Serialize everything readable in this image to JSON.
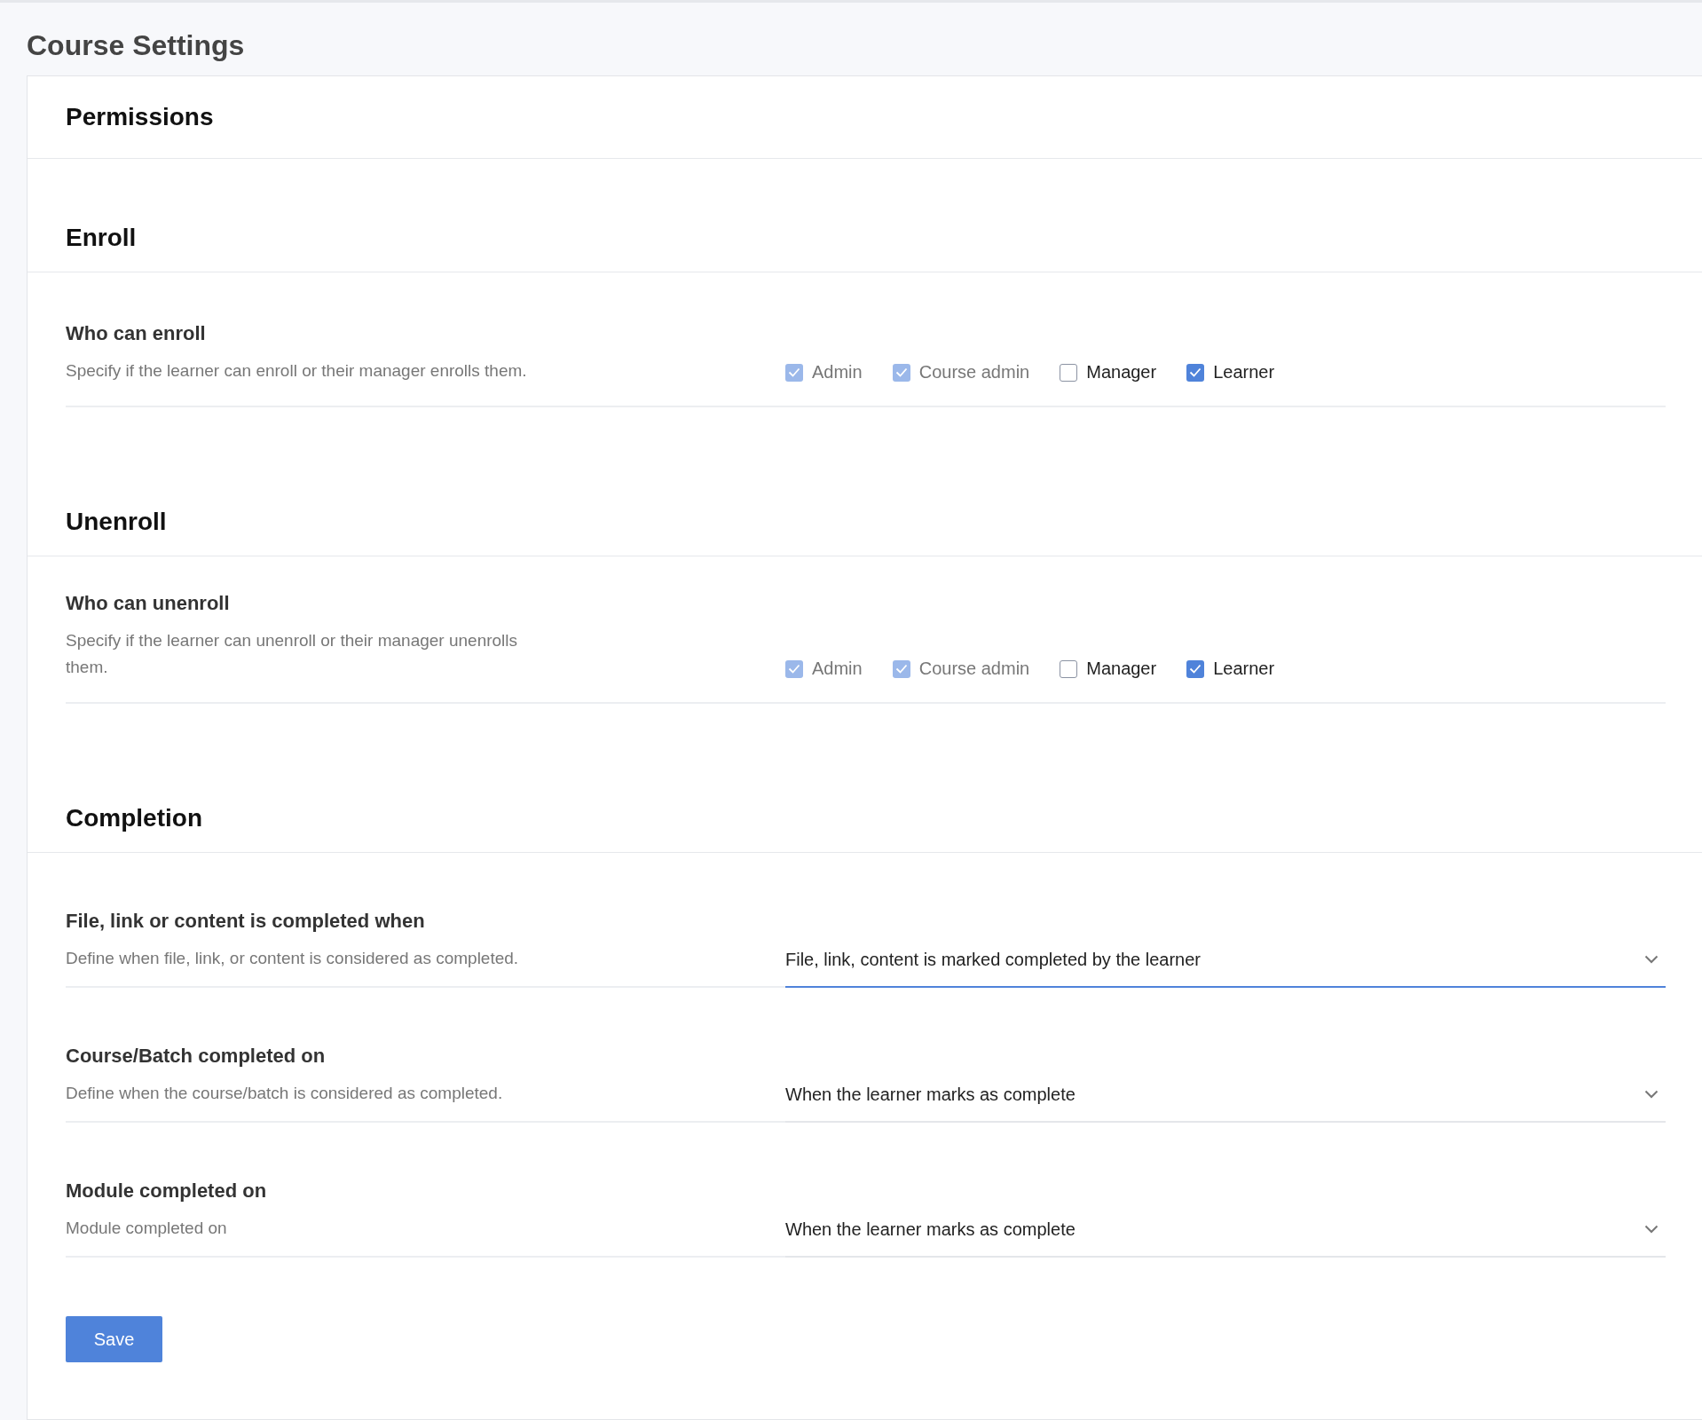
{
  "page_title": "Course Settings",
  "card_title": "Permissions",
  "sections": [
    {
      "heading": "Enroll",
      "rows": [
        {
          "kind": "checkboxes",
          "title": "Who can enroll",
          "description": "Specify if the learner can enroll or their manager enrolls them.",
          "options": [
            {
              "label": "Admin",
              "checked": true,
              "disabled": true
            },
            {
              "label": "Course admin",
              "checked": true,
              "disabled": true
            },
            {
              "label": "Manager",
              "checked": false,
              "disabled": false
            },
            {
              "label": "Learner",
              "checked": true,
              "disabled": false
            }
          ]
        }
      ]
    },
    {
      "heading": "Unenroll",
      "rows": [
        {
          "kind": "checkboxes",
          "title": "Who can unenroll",
          "description": "Specify if the learner can unenroll or their manager unenrolls them.",
          "options": [
            {
              "label": "Admin",
              "checked": true,
              "disabled": true
            },
            {
              "label": "Course admin",
              "checked": true,
              "disabled": true
            },
            {
              "label": "Manager",
              "checked": false,
              "disabled": false
            },
            {
              "label": "Learner",
              "checked": true,
              "disabled": false
            }
          ]
        }
      ]
    },
    {
      "heading": "Completion",
      "rows": [
        {
          "kind": "select",
          "title": "File, link or content is completed when",
          "description": "Define when file, link, or content is considered as completed.",
          "value": "File, link, content is marked completed by the learner",
          "focused": true
        },
        {
          "kind": "select",
          "title": "Course/Batch completed on",
          "description": "Define when the course/batch is considered as completed.",
          "value": "When the learner marks as complete",
          "focused": false
        },
        {
          "kind": "select",
          "title": "Module completed on",
          "description": "Module completed on",
          "value": "When the learner marks as complete",
          "focused": false
        }
      ]
    }
  ],
  "save_button": "Save"
}
